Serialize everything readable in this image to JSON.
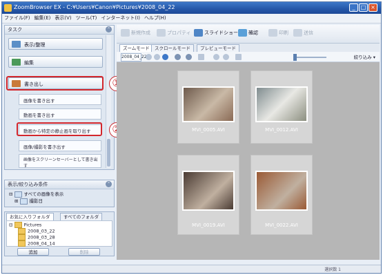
{
  "window": {
    "title": "ZoomBrowser EX - C:¥Users¥Canon¥Pictures¥2008_04_22",
    "controls": [
      "_",
      "□",
      "×"
    ]
  },
  "menu": [
    "ファイル(F)",
    "編集(E)",
    "表示(V)",
    "ツール(T)",
    "インターネット(I)",
    "ヘルプ(H)"
  ],
  "left": {
    "task_title": "タスク",
    "categories": [
      "表示/整理",
      "編集",
      "書き出し"
    ],
    "actions": [
      "画像を書き出す",
      "動画を書き出す",
      "動画から特定の静止画を取り出す",
      "画像/撮影を書き出す",
      "画像をスクリーンセーバーとして書き出す"
    ],
    "filter_title": "表示/絞り込み条件",
    "filter_items": [
      "すべての画像を表示",
      "撮影日"
    ],
    "folder_tabs": [
      "お気に入りフォルダ",
      "すべてのフォルダ"
    ],
    "folders": [
      "Pictures",
      "2008_03_22",
      "2008_03_28",
      "2008_04_14"
    ],
    "buttons": [
      "追加",
      "削除"
    ]
  },
  "toolbar": {
    "items": [
      "新規作成",
      "プロパティ",
      "スライドショー",
      "確認",
      "印刷",
      "送信"
    ]
  },
  "tabs": [
    "ズームモード",
    "スクロールモード",
    "プレビューモード"
  ],
  "viewbar": {
    "folder": "2008_04_22",
    "filter_label": "絞り込み"
  },
  "thumbnails": [
    {
      "name": "MVI_0005.AVI",
      "color": "#8a6a55"
    },
    {
      "name": "MVI_0012.AVI",
      "color": "#8c8f80"
    },
    {
      "name": "MVI_0019.AVI",
      "color": "#4a3b33"
    },
    {
      "name": "MVI_0022.AVI",
      "color": "#9a5a35"
    }
  ],
  "annotations": [
    "①",
    "②"
  ],
  "status": "選択数 1"
}
